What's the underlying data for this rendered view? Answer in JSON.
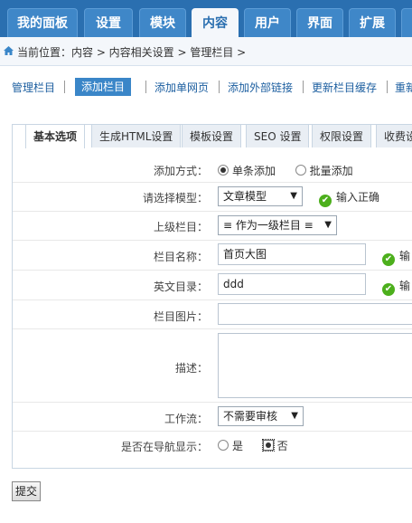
{
  "topnav": {
    "tabs": [
      {
        "label": "我的面板"
      },
      {
        "label": "设置"
      },
      {
        "label": "模块"
      },
      {
        "label": "内容"
      },
      {
        "label": "用户"
      },
      {
        "label": "界面"
      },
      {
        "label": "扩展"
      }
    ],
    "active_index": 3
  },
  "breadcrumb": {
    "text": "当前位置：内容 > 内容相关设置 > 管理栏目 >"
  },
  "subnav": {
    "links": [
      {
        "label": "管理栏目"
      },
      {
        "label": "添加栏目"
      },
      {
        "label": "添加单网页"
      },
      {
        "label": "添加外部链接"
      },
      {
        "label": "更新栏目缓存"
      },
      {
        "label": "重新"
      }
    ],
    "active_index": 1
  },
  "panel_tabs": [
    {
      "label": "基本选项"
    },
    {
      "label": "生成HTML设置"
    },
    {
      "label": "模板设置"
    },
    {
      "label": "SEO 设置"
    },
    {
      "label": "权限设置"
    },
    {
      "label": "收费设"
    }
  ],
  "form": {
    "add_method": {
      "label": "添加方式：",
      "opt1": "单条添加",
      "opt2": "批量添加"
    },
    "model": {
      "label": "请选择模型：",
      "value": "文章模型",
      "msg": "输入正确"
    },
    "parent": {
      "label": "上级栏目：",
      "value": "≡ 作为一级栏目 ≡"
    },
    "name": {
      "label": "栏目名称：",
      "value": "首页大图",
      "msg": "输"
    },
    "dir": {
      "label": "英文目录：",
      "value": "ddd",
      "msg": "输"
    },
    "image": {
      "label": "栏目图片：",
      "value": ""
    },
    "desc": {
      "label": "描述：",
      "value": ""
    },
    "workflow": {
      "label": "工作流：",
      "value": "不需要审核"
    },
    "nav": {
      "label": "是否在导航显示：",
      "opt_yes": "是",
      "opt_no": "否"
    }
  },
  "submit_label": "提交",
  "colors": {
    "nav_bg": "#2a6fb0",
    "accent": "#3a86c8",
    "ok": "#4caf1c"
  }
}
